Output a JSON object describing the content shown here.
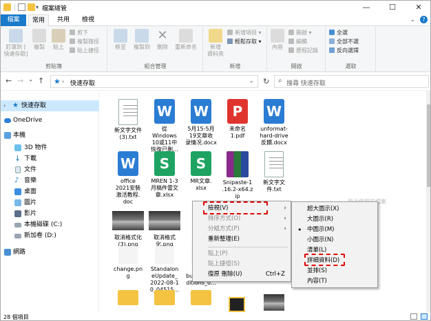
{
  "window": {
    "title": "檔案總管",
    "minimize": "—",
    "maximize": "☐",
    "close": "✕"
  },
  "tabs": {
    "file": "檔案",
    "home": "常用",
    "share": "共用",
    "view": "檢視"
  },
  "ribbon": {
    "pin": "釘選到 [\n快速存取]",
    "copy": "複製",
    "paste": "貼上",
    "cut": "剪下",
    "copy_path": "複製路徑",
    "paste_shortcut": "貼上捷徑",
    "clipboard_group": "剪貼簿",
    "move_to": "移至",
    "copy_to": "複製到",
    "delete": "刪除",
    "rename": "重新命名",
    "organize_group": "組合管理",
    "new_folder": "新增\n資料夾",
    "new_item": "新增項目 ▾",
    "easy_access": "輕鬆存取 ▾",
    "new_group": "新增",
    "properties": "內容",
    "open": "開啟 ▾",
    "edit": "編輯",
    "history": "歷程記錄",
    "open_group": "開啟",
    "select_all": "全選",
    "select_none": "全部不選",
    "invert": "反向選擇",
    "select_group": "選取"
  },
  "address": {
    "back": "←",
    "forward": "→",
    "recent": "⌄",
    "up": "↑",
    "path": "快速存取",
    "refresh": "↻",
    "search_placeholder": "搜尋 快速存取"
  },
  "nav": {
    "items": [
      {
        "label": "快速存取"
      },
      {
        "label": "OneDrive"
      },
      {
        "label": "本機"
      },
      {
        "label": "3D 物件"
      },
      {
        "label": "下載"
      },
      {
        "label": "文件"
      },
      {
        "label": "音樂"
      },
      {
        "label": "桌面"
      },
      {
        "label": "圖片"
      },
      {
        "label": "影片"
      },
      {
        "label": "本機磁碟 (C:)"
      },
      {
        "label": "新加卷 (D:)"
      },
      {
        "label": "網路"
      }
    ]
  },
  "files": [
    {
      "name": "新文字文件\n(3).txt"
    },
    {
      "name": "從\nWindows\n10或11中\n恢復已刪..."
    },
    {
      "name": "5月15-5月\n19文章收\n录情况.docx"
    },
    {
      "name": "未命名\n1.pdf"
    },
    {
      "name": "unformat-\nhard-drive\n反饋.docx"
    },
    {
      "name": "office\n2021安裝\n激活教程.\ndoc"
    },
    {
      "name": "MREN 1-3\n月稿件雷文\n章.xlsx"
    },
    {
      "name": "MR文章.\nxlsx"
    },
    {
      "name": "Snipaste-1\n.16.2-x64.z\nip"
    },
    {
      "name": "新文字文\n件.txt"
    },
    {
      "name": "取消格式化\n(3).png"
    },
    {
      "name": "取消格式\n化.png"
    },
    {
      "name": "change.pn\ng"
    },
    {
      "name": "Standalon\neUpdate_\n2022-08-1\n0_04515..."
    },
    {
      "name": "zh...\nbusiness_e\nditions_u..."
    }
  ],
  "file_icons": {
    "wps_word": "W",
    "wps_sheet": "S",
    "pdf": "P"
  },
  "partial_label": "最近使用的檔案",
  "status": {
    "count": "28 個項目"
  },
  "context_menu": {
    "items": [
      {
        "label": "檢視(V)"
      },
      {
        "label": "排序方式(O)"
      },
      {
        "label": "分組方式(P)"
      },
      {
        "label": "重新整理(E)"
      },
      {
        "label": "貼上(P)"
      },
      {
        "label": "貼上捷徑(S)"
      },
      {
        "label": "復原 刪除(U)",
        "shortcut": "Ctrl+Z"
      }
    ]
  },
  "submenu": {
    "items": [
      {
        "label": "超大圖示(X)"
      },
      {
        "label": "大圖示(R)"
      },
      {
        "label": "中圖示(M)",
        "checked": true
      },
      {
        "label": "小圖示(N)"
      },
      {
        "label": "清單(L)"
      },
      {
        "label": "詳細資料(D)"
      },
      {
        "label": "並排(S)"
      },
      {
        "label": "內容(T)"
      }
    ],
    "bullet": "•"
  },
  "colors": {
    "accent": "#1979ca",
    "highlight_border": "#e00000",
    "wps_word": "#2b7cd3",
    "wps_sheet": "#1ea362",
    "pdf": "#e0342f",
    "folder": "#f5c342"
  }
}
